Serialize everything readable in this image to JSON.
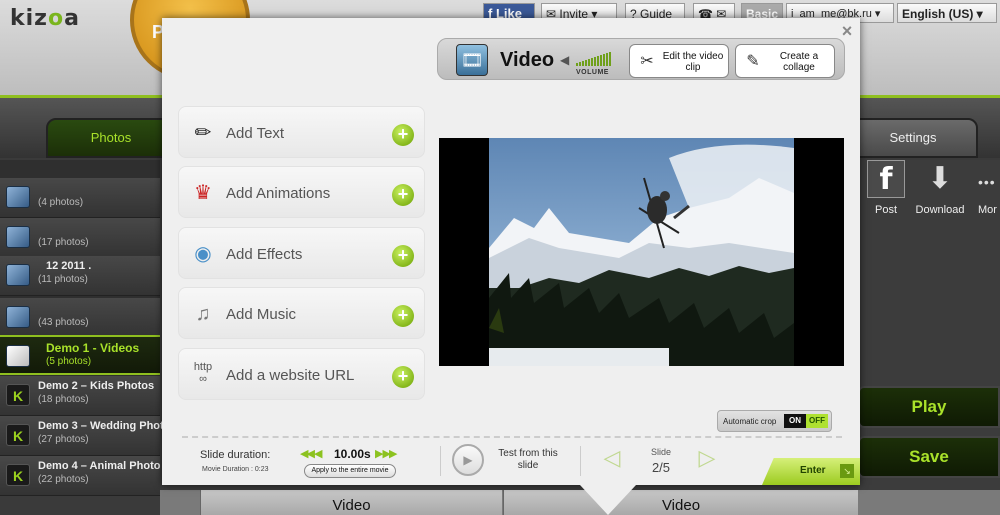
{
  "app": {
    "logo": "kiz",
    "logo_accent": "o",
    "logo_tail": "a",
    "badge_text": "P"
  },
  "topbar": {
    "like": "Like",
    "invite": "Invite",
    "guide": "Guide",
    "basic": "Basic",
    "user": "i_am_me@bk.ru",
    "language": "English (US)"
  },
  "tabs": {
    "photos": "Photos",
    "settings": "Settings"
  },
  "albums": [
    {
      "title": "",
      "count": "(4 photos)"
    },
    {
      "title": "",
      "count": "(17 photos)"
    },
    {
      "title": "12  2011 .",
      "count": "(11 photos)"
    },
    {
      "title": "",
      "count": "(43 photos)"
    },
    {
      "title": "Demo 1 - Videos",
      "count": "(5 photos)"
    },
    {
      "title": "Demo 2 – Kids Photos",
      "count": "(18 photos)"
    },
    {
      "title": "Demo 3 – Wedding Phot",
      "count": "(27 photos)"
    },
    {
      "title": "Demo 4 – Animal Photo",
      "count": "(22 photos)"
    }
  ],
  "share": {
    "post": "Post",
    "download": "Download",
    "more": "Mor"
  },
  "actions": {
    "play": "Play",
    "save": "Save"
  },
  "bottom_tabs": [
    "Video",
    "Video"
  ],
  "modal": {
    "close": "×",
    "video_label": "Video",
    "volume_label": "VOLUME",
    "volume_level": 1.0,
    "edit_clip": "Edit the video clip",
    "create_collage": "Create a collage",
    "add_items": [
      {
        "label": "Add Text",
        "icon": "pencil-icon"
      },
      {
        "label": "Add Animations",
        "icon": "jester-icon"
      },
      {
        "label": "Add Effects",
        "icon": "snowglobe-icon"
      },
      {
        "label": "Add Music",
        "icon": "music-note-icon"
      },
      {
        "label": "Add a website URL",
        "icon": "link-icon"
      }
    ],
    "plus": "+",
    "auto_crop": {
      "label": "Automatic crop",
      "on": "ON",
      "off": "OFF"
    },
    "slide_duration_label": "Slide duration:",
    "slide_duration_value": "10.00s",
    "movie_duration": "Movie Duration : 0:23",
    "apply_entire": "Apply to the entire movie",
    "test_from_slide": "Test from this slide",
    "slide_label": "Slide",
    "slide_value": "2/5",
    "enter": "Enter"
  },
  "colors": {
    "accent": "#8fbf1f",
    "lime": "#a9e22a",
    "facebook": "#3b5998"
  }
}
